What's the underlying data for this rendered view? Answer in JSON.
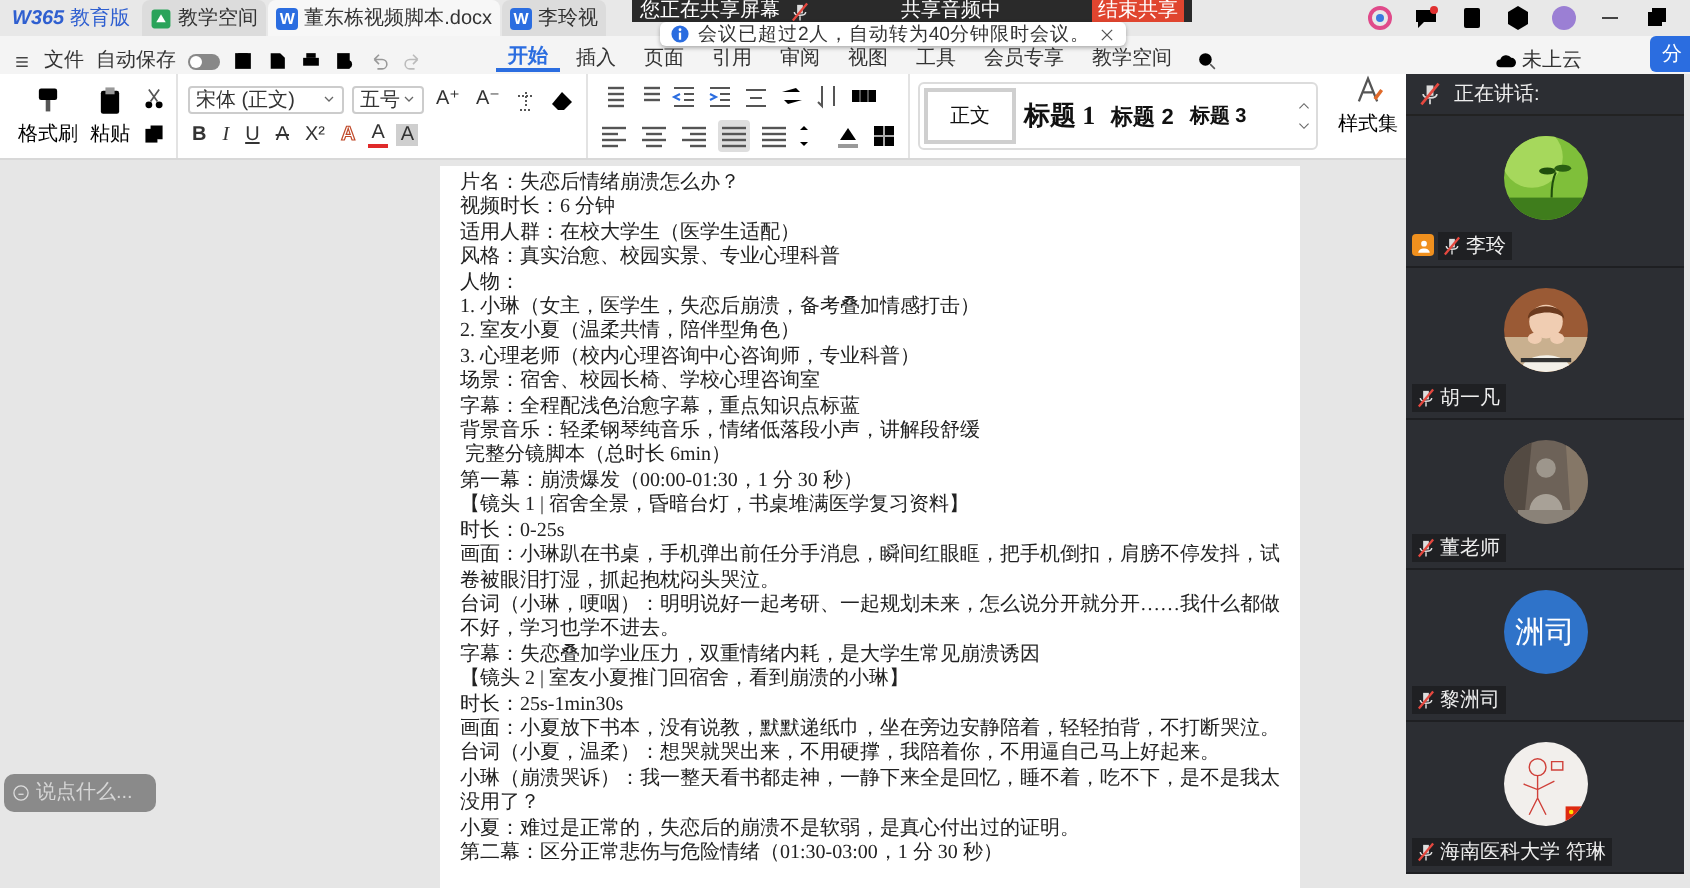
{
  "title_bar": {
    "brand": {
      "name": "W365",
      "edition": "教育版"
    },
    "tabs": [
      {
        "label": "教学空间",
        "kind": "space",
        "selected": false
      },
      {
        "label": "董东栋视频脚本.docx",
        "kind": "doc",
        "badge": "W",
        "selected": true
      },
      {
        "label": "李玲视",
        "kind": "doc",
        "badge": "W",
        "selected": false
      }
    ]
  },
  "share_bar": {
    "status": "您正在共享屏幕",
    "audio": "共享音频中",
    "stop": "结束共享"
  },
  "toast": {
    "message": "会议已超过2人，自动转为40分钟限时会议。"
  },
  "menu": {
    "file": "文件",
    "autosave": {
      "label": "自动保存",
      "on": false
    },
    "tabs": [
      {
        "label": "开始",
        "selected": true
      },
      {
        "label": "插入",
        "selected": false
      },
      {
        "label": "页面",
        "selected": false
      },
      {
        "label": "引用",
        "selected": false
      },
      {
        "label": "审阅",
        "selected": false
      },
      {
        "label": "视图",
        "selected": false
      },
      {
        "label": "工具",
        "selected": false
      },
      {
        "label": "会员专享",
        "selected": false
      },
      {
        "label": "教学空间",
        "selected": false
      }
    ],
    "cloud": "未上云",
    "share": "分"
  },
  "ribbon": {
    "format_painter": "格式刷",
    "paste": "粘贴",
    "font": "宋体 (正文)",
    "size": "五号",
    "size_buttons": [
      "A⁺",
      "A⁻"
    ],
    "format_buttons": [
      {
        "label": "B",
        "kind": "bold"
      },
      {
        "label": "I",
        "kind": "italic"
      },
      {
        "label": "U",
        "kind": "underline"
      },
      {
        "label": "A",
        "kind": "strike"
      },
      {
        "label": "X²",
        "kind": "plain"
      },
      {
        "label": "A",
        "kind": "outline"
      },
      {
        "label": "A",
        "kind": "color"
      },
      {
        "label": "A",
        "kind": "shade"
      }
    ],
    "alignments": [
      {
        "kind": "left",
        "selected": false
      },
      {
        "kind": "center",
        "selected": false
      },
      {
        "kind": "right",
        "selected": false
      },
      {
        "kind": "justify",
        "selected": true
      },
      {
        "kind": "distributed",
        "selected": false
      }
    ],
    "styles": [
      {
        "label": "正文",
        "kind": "normal"
      },
      {
        "label": "标题 1",
        "kind": "h1"
      },
      {
        "label": "标题 2",
        "kind": "h2"
      },
      {
        "label": "标题 3",
        "kind": "h3"
      }
    ],
    "style_set": "样式集"
  },
  "document": {
    "lines": [
      "片名：失恋后情绪崩溃怎么办？",
      "视频时长：6 分钟",
      "适用人群：在校大学生（医学生适配）",
      "风格：真实治愈、校园实景、专业心理科普",
      "人物：",
      "1. 小琳（女主，医学生，失恋后崩溃，备考叠加情感打击）",
      "2. 室友小夏（温柔共情，陪伴型角色）",
      "3. 心理老师（校内心理咨询中心咨询师，专业科普）",
      "场景：宿舍、校园长椅、学校心理咨询室",
      "字幕：全程配浅色治愈字幕，重点知识点标蓝",
      "背景音乐：轻柔钢琴纯音乐，情绪低落段小声，讲解段舒缓",
      " 完整分镜脚本（总时长 6min）",
      "第一幕：崩溃爆发（00:00-01:30，1 分 30 秒）",
      "【镜头 1 | 宿舍全景，昏暗台灯，书桌堆满医学复习资料】",
      "时长：0-25s",
      "画面：小琳趴在书桌，手机弹出前任分手消息，瞬间红眼眶，把手机倒扣，肩膀不停发抖，试卷被眼泪打湿，抓起抱枕闷头哭泣。",
      "台词（小琳，哽咽）：明明说好一起考研、一起规划未来，怎么说分开就分开……我什么都做不好，学习也学不进去。",
      "字幕：失恋叠加学业压力，双重情绪内耗，是大学生常见崩溃诱因",
      "【镜头 2 | 室友小夏推门回宿舍，看到崩溃的小琳】",
      "时长：25s-1min30s",
      "画面：小夏放下书本，没有说教，默默递纸巾，坐在旁边安静陪着，轻轻拍背，不打断哭泣。",
      "台词（小夏，温柔）：想哭就哭出来，不用硬撑，我陪着你，不用逼自己马上好起来。",
      "小琳（崩溃哭诉）：我一整天看书都走神，一静下来全是回忆，睡不着，吃不下，是不是我太没用了？",
      "小夏：难过是正常的，失恋后的崩溃不是软弱，是真心付出过的证明。",
      "第二幕：区分正常悲伤与危险情绪（01:30-03:00，1 分 30 秒）"
    ]
  },
  "chat_input": {
    "placeholder": "说点什么..."
  },
  "meeting": {
    "header": "正在讲话:",
    "participants": [
      {
        "name": "李玲",
        "host": true,
        "muted": true
      },
      {
        "name": "胡一凡",
        "host": false,
        "muted": true
      },
      {
        "name": "董老师",
        "host": false,
        "muted": true
      },
      {
        "name": "黎洲司",
        "host": false,
        "muted": true,
        "avatar": {
          "kind": "text",
          "text": "洲司"
        }
      },
      {
        "name": "海南医科大学 符琳",
        "host": false,
        "muted": true
      }
    ]
  }
}
